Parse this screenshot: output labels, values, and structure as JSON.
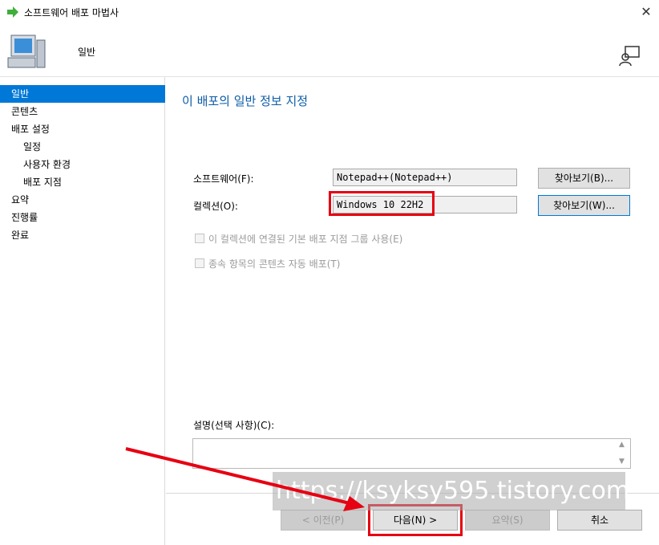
{
  "window": {
    "title": "소프트웨어 배포 마법사"
  },
  "header": {
    "title": "일반"
  },
  "sidebar": {
    "items": [
      {
        "label": "일반",
        "active": true,
        "sub": false
      },
      {
        "label": "콘텐츠",
        "active": false,
        "sub": false
      },
      {
        "label": "배포 설정",
        "active": false,
        "sub": false
      },
      {
        "label": "일정",
        "active": false,
        "sub": true
      },
      {
        "label": "사용자 환경",
        "active": false,
        "sub": true
      },
      {
        "label": "배포 지점",
        "active": false,
        "sub": true
      },
      {
        "label": "요약",
        "active": false,
        "sub": false
      },
      {
        "label": "진행률",
        "active": false,
        "sub": false
      },
      {
        "label": "완료",
        "active": false,
        "sub": false
      }
    ]
  },
  "main": {
    "heading": "이 배포의 일반 정보 지정",
    "software": {
      "label": "소프트웨어(F):",
      "value": "Notepad++(Notepad++)",
      "browse": "찾아보기(B)..."
    },
    "collection": {
      "label": "컬렉션(O):",
      "value": "Windows 10 22H2",
      "browse": "찾아보기(W)..."
    },
    "options": [
      {
        "label": "이 컬렉션에 연결된 기본 배포 지점 그룹 사용(E)",
        "checked": false,
        "enabled": false
      },
      {
        "label": "종속 항목의 콘텐츠 자동 배포(T)",
        "checked": false,
        "enabled": false
      }
    ],
    "description": {
      "label": "설명(선택 사항)(C):",
      "value": ""
    }
  },
  "footer": {
    "prev": "< 이전(P)",
    "next": "다음(N) >",
    "summary": "요약(S)",
    "cancel": "취소"
  },
  "watermark": "https://ksyksy595.tistory.com",
  "colors": {
    "accent": "#0078d7",
    "heading": "#0d5ca8",
    "highlight": "#e60012"
  }
}
